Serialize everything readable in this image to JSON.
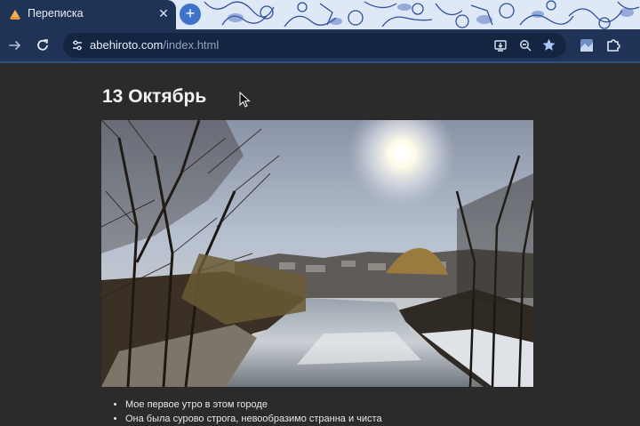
{
  "browser": {
    "tab": {
      "title": "Переписка",
      "close_glyph": "✕"
    },
    "new_tab_glyph": "+",
    "address": {
      "host": "abehiroto.com",
      "path": "/index.html"
    },
    "icons": {
      "back": "arrow-right-icon",
      "reload": "reload-icon",
      "site_info": "tune-icon",
      "install": "install-app-icon",
      "zoom": "zoom-icon",
      "bookmark": "star-icon",
      "extension": "extension-icon",
      "puzzle": "puzzle-icon"
    },
    "colors": {
      "frame": "#1f3356",
      "omnibox": "#142542",
      "accent": "#3f73c9",
      "star": "#a8c7fa"
    }
  },
  "page": {
    "heading": "13 Октябрь",
    "photo_alt": "Зимняя река на рассвете",
    "notes": [
      "Мое первое утро в этом городе",
      "Она была сурово строга, невообразимо странна и чиста"
    ],
    "background": "#2b2b2b"
  }
}
